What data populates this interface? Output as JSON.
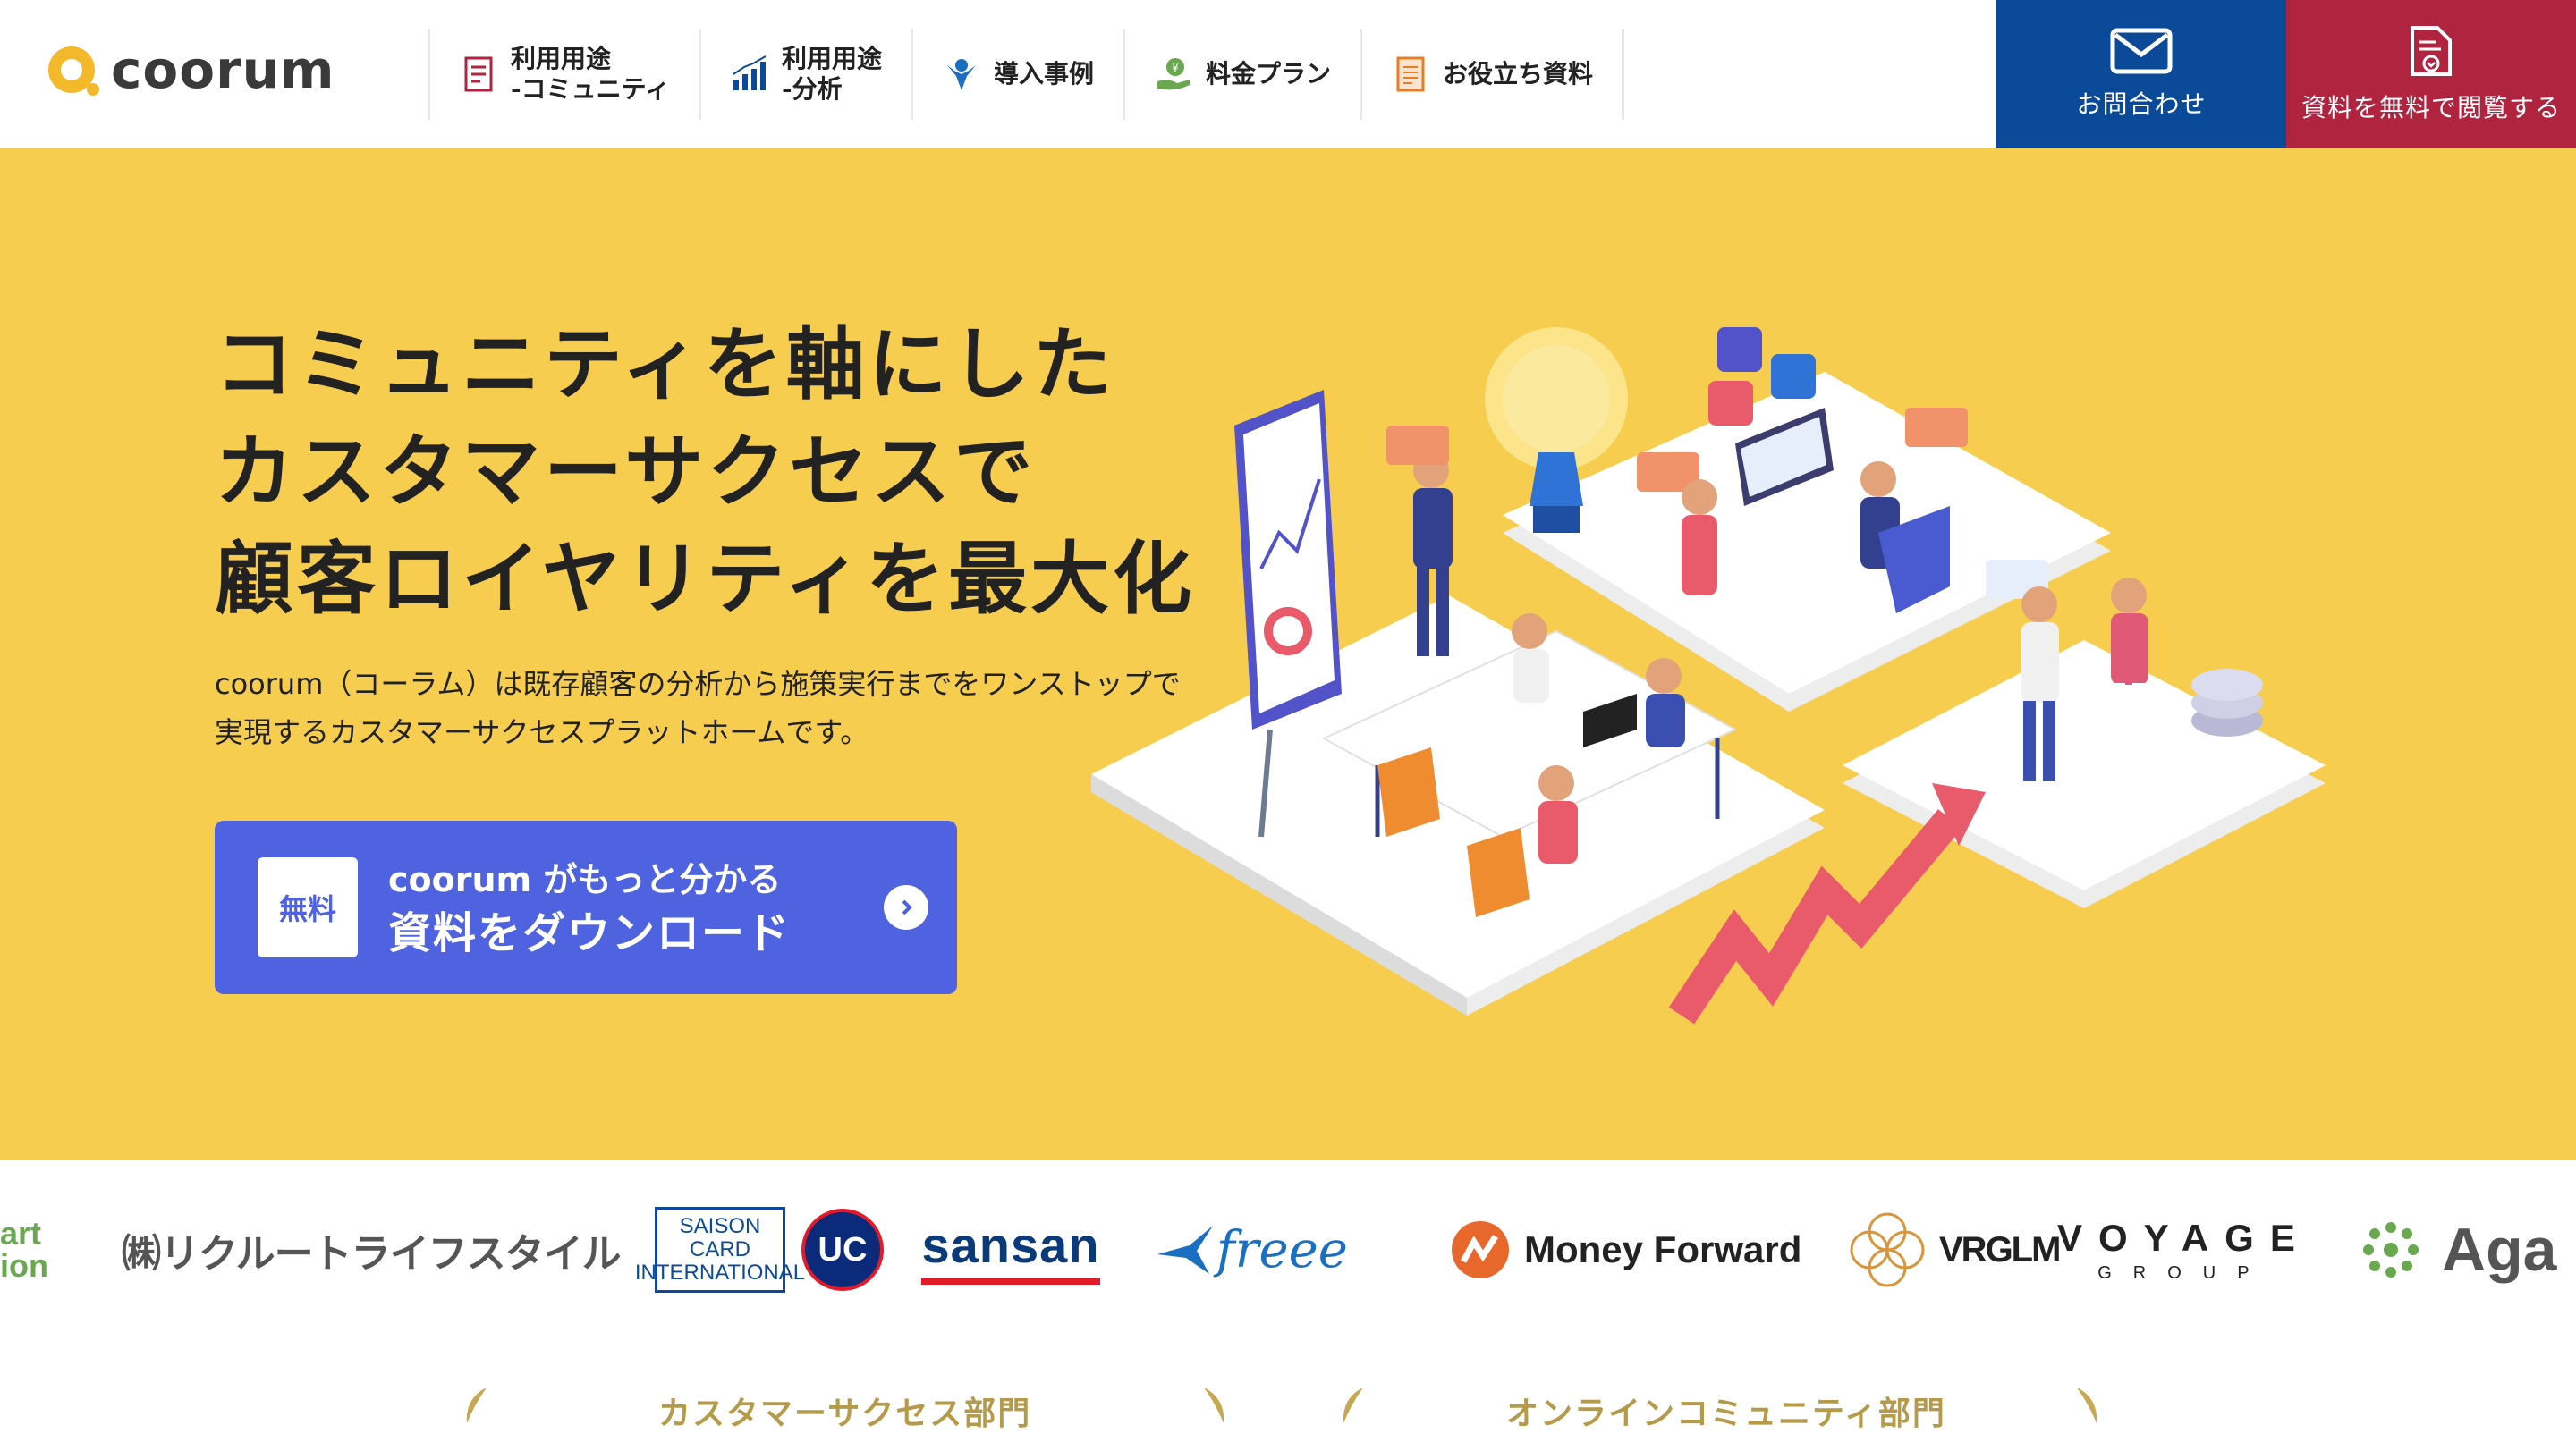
{
  "header": {
    "logo_text": "coorum",
    "nav": [
      {
        "label": "利用用途\n-コミュニティ",
        "icon": "document-icon"
      },
      {
        "label": "利用用途\n-分析",
        "icon": "bar-chart-icon"
      },
      {
        "label": "導入事例",
        "icon": "people-icon"
      },
      {
        "label": "料金プラン",
        "icon": "money-hand-icon"
      },
      {
        "label": "お役立ち資料",
        "icon": "notebook-icon"
      }
    ],
    "contact_label": "お問合わせ",
    "doc_label": "資料を無料で閲覧する"
  },
  "hero": {
    "title_lines": [
      "コミュニティを軸にした",
      "カスタマーサクセスで",
      "顧客ロイヤリティを最大化"
    ],
    "description": "coorum（コーラム）は既存顧客の分析から施策実行までをワンストップで実現するカスタマーサクセスプラットホームです。",
    "cta": {
      "badge": "無料",
      "line1": "coorum がもっと分かる",
      "line2": "資料をダウンロード"
    }
  },
  "client_logos": [
    {
      "text": "art\nion"
    },
    {
      "text": "㈱リクルートライフスタイル"
    },
    {
      "text": "SAISON\nCARD\nINTERNATIONAL"
    },
    {
      "text": "UC"
    },
    {
      "text": "sansan"
    },
    {
      "text": "freee"
    },
    {
      "text": "Money Forward"
    },
    {
      "text": "VRGLM"
    },
    {
      "text": "VOYAGE"
    },
    {
      "text": "GROUP"
    },
    {
      "text": "Aga"
    }
  ],
  "awards": [
    "カスタマーサクセス部門",
    "オンラインコミュニティ部門"
  ],
  "colors": {
    "hero_bg": "#f6cd4f",
    "contact_bg": "#0b4a98",
    "doc_bg": "#b0243f",
    "cta_bg": "#4f63e0"
  }
}
